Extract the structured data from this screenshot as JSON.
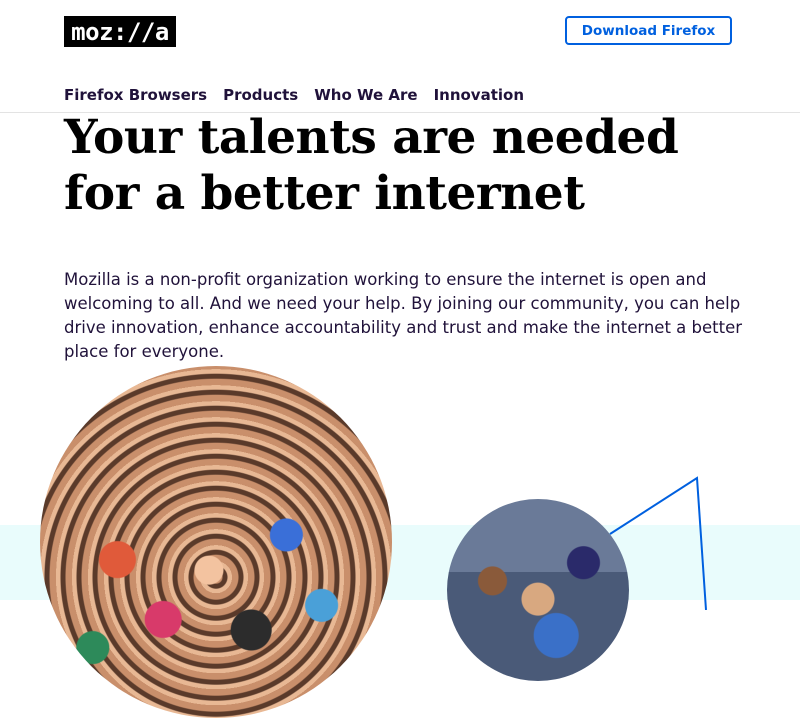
{
  "header": {
    "logo_text": "moz://a",
    "download_label": "Download Firefox",
    "nav": [
      {
        "label": "Firefox Browsers"
      },
      {
        "label": "Products"
      },
      {
        "label": "Who We Are"
      },
      {
        "label": "Innovation"
      }
    ]
  },
  "hero": {
    "headline": "Your talents are needed for a better internet",
    "intro": "Mozilla is a non-profit organization working to ensure the internet is open and welcoming to all. And we need your help. By joining our community, you can help drive innovation, enhance accountability and trust and make the internet a better place for everyone."
  },
  "colors": {
    "brand_blue": "#0060df",
    "text": "#20123a",
    "band": "#e9fcfc"
  }
}
